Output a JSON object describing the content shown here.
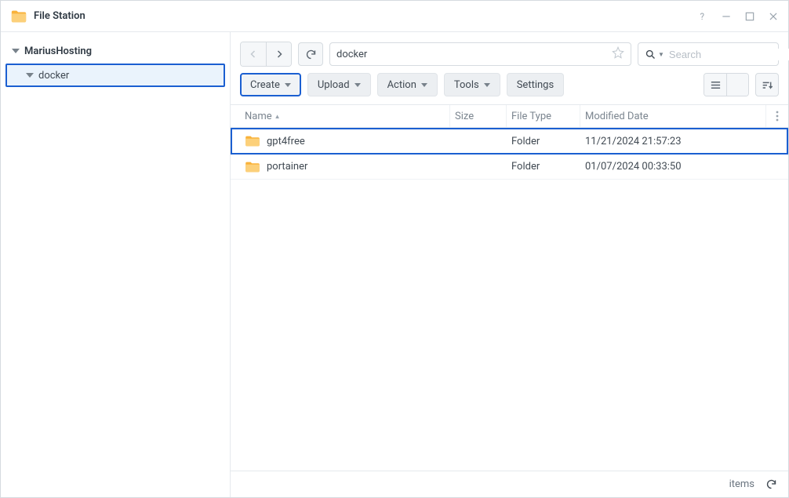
{
  "app": {
    "title": "File Station"
  },
  "sidebar": {
    "root": "MariusHosting",
    "items": [
      {
        "label": "docker",
        "selected": true
      }
    ]
  },
  "path": {
    "value": "docker"
  },
  "search": {
    "placeholder": "Search"
  },
  "toolbar": {
    "create": "Create",
    "upload": "Upload",
    "action": "Action",
    "tools": "Tools",
    "settings": "Settings"
  },
  "columns": {
    "name": "Name",
    "size": "Size",
    "type": "File Type",
    "date": "Modified Date"
  },
  "rows": [
    {
      "name": "gpt4free",
      "size": "",
      "type": "Folder",
      "date": "11/21/2024 21:57:23",
      "selected": true
    },
    {
      "name": "portainer",
      "size": "",
      "type": "Folder",
      "date": "01/07/2024 00:33:50",
      "selected": false
    }
  ],
  "status": {
    "items_label": "items"
  }
}
